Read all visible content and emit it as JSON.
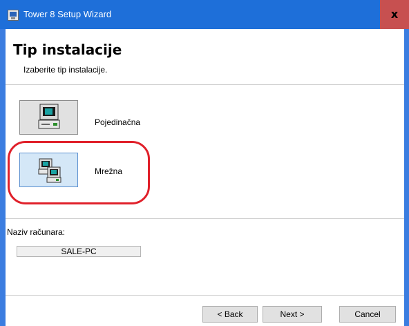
{
  "window": {
    "title": "Tower 8 Setup Wizard",
    "close_label": "x"
  },
  "header": {
    "title": "Tip instalacije",
    "subtitle": "Izaberite tip instalacije."
  },
  "options": [
    {
      "label": "Pojedinačna",
      "icon": "single-computer-icon",
      "selected": false
    },
    {
      "label": "Mrežna",
      "icon": "network-computers-icon",
      "selected": true
    }
  ],
  "computer": {
    "label": "Naziv računara:",
    "value": "SALE-PC"
  },
  "buttons": {
    "back": "< Back",
    "next": "Next >",
    "cancel": "Cancel"
  },
  "colors": {
    "highlight": "#e0202a",
    "titlebar": "#1e6fd9",
    "selected_option": "#d4e7f7"
  }
}
